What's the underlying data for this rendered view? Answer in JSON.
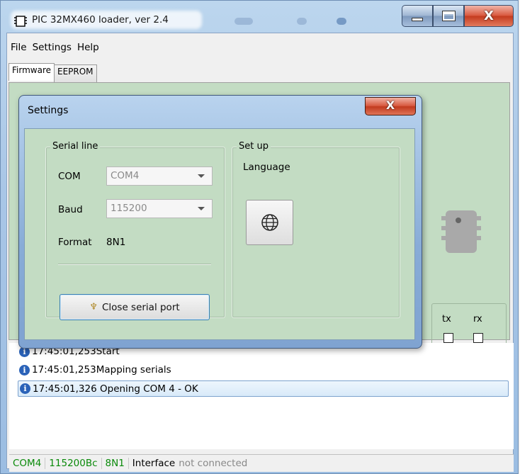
{
  "window": {
    "title": "PIC 32MX460 loader, ver 2.4",
    "min_icon": "minimize-icon",
    "max_icon": "maximize-icon",
    "close_label": "X"
  },
  "menu": [
    "File",
    "Settings",
    "Help"
  ],
  "tabs": [
    {
      "label": "Firmware",
      "active": true
    },
    {
      "label": "EEPROM",
      "active": false
    }
  ],
  "panel": {
    "chip_icon": "chip-icon",
    "tx_label": "tx",
    "rx_label": "rx",
    "background": "#c3dcc3"
  },
  "log": [
    {
      "icon": "info-icon",
      "time": "17:45:01,253",
      "text": "Start"
    },
    {
      "icon": "info-icon",
      "time": "17:45:01,253",
      "text": "Mapping serials"
    },
    {
      "icon": "info-icon",
      "time": "17:45:01,326",
      "text": " Opening COM 4 - OK",
      "selected": true
    }
  ],
  "statusbar": {
    "port": "COM4",
    "baud": "115200Bc",
    "format": "8N1",
    "interface": "Interface",
    "state": "not connected"
  },
  "dialog": {
    "title": "Settings",
    "close_label": "X",
    "serial_group": {
      "title": "Serial line",
      "com_label": "COM",
      "com_value": "COM4",
      "baud_label": "Baud",
      "baud_value": "115200",
      "format_label": "Format",
      "format_value": "8N1",
      "close_button": "Close serial port",
      "close_button_icon": "plug-icon"
    },
    "setup_group": {
      "title": "Set up",
      "language_label": "Language",
      "language_icon": "globe-icon"
    }
  },
  "colors": {
    "panel_green": "#c3dcc3",
    "status_green": "#0a8a0a",
    "info_blue": "#2a62b8",
    "close_red": "#c43b1f"
  }
}
